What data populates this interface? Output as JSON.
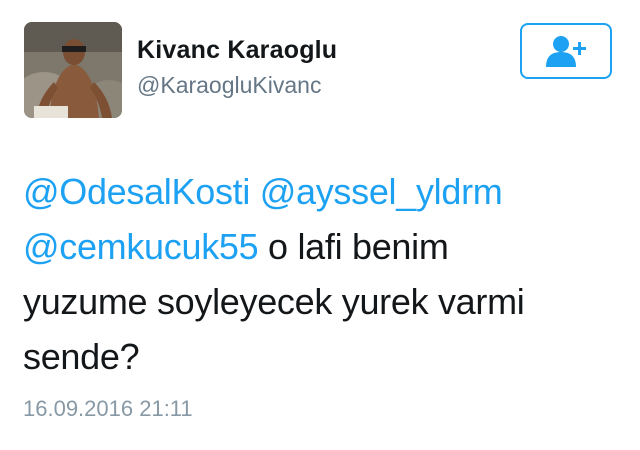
{
  "user": {
    "display_name": "Kivanc Karaoglu",
    "handle": "@KaraogluKivanc",
    "avatar_icon": "profile-photo"
  },
  "follow_button": {
    "icon": "add-user-icon"
  },
  "tweet": {
    "mention_1": "@OdesalKosti",
    "mention_2": "@ayssel_yldrm",
    "mention_3": "@cemkucuk55",
    "text_line_1": " o lafi benim",
    "text_line_2": "yuzume soyleyecek yurek varmi",
    "text_line_3": "sende?",
    "timestamp": "16.09.2016 21:11"
  },
  "colors": {
    "mention": "#1da1f2",
    "text": "#14171a",
    "muted": "#8899a6"
  }
}
